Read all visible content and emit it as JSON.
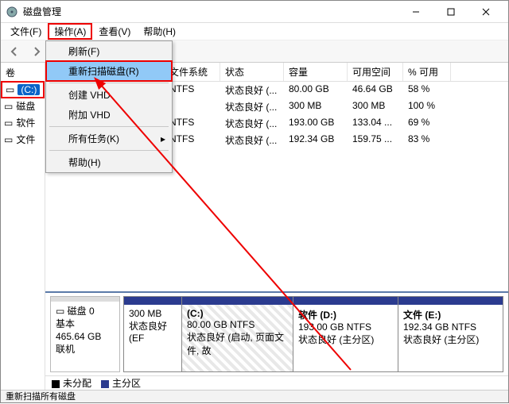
{
  "title": "磁盘管理",
  "menubar": {
    "file": "文件(F)",
    "action": "操作(A)",
    "view": "查看(V)",
    "help": "帮助(H)"
  },
  "dropdown": {
    "refresh": "刷新(F)",
    "rescan": "重新扫描磁盘(R)",
    "create_vhd": "创建 VHD",
    "attach_vhd": "附加 VHD",
    "all_tasks": "所有任务(K)",
    "help": "帮助(H)"
  },
  "left": {
    "header": "卷",
    "items": [
      "(C:)",
      "磁盘",
      "软件",
      "文件"
    ]
  },
  "grid": {
    "headers": {
      "fs": "文件系统",
      "status": "状态",
      "capacity": "容量",
      "free": "可用空间",
      "pct": "% 可用"
    },
    "rows": [
      {
        "fs": "NTFS",
        "status": "状态良好 (...",
        "capacity": "80.00 GB",
        "free": "46.64 GB",
        "pct": "58 %"
      },
      {
        "fs": "",
        "status": "状态良好 (...",
        "capacity": "300 MB",
        "free": "300 MB",
        "pct": "100 %"
      },
      {
        "fs": "NTFS",
        "status": "状态良好 (...",
        "capacity": "193.00 GB",
        "free": "133.04 ...",
        "pct": "69 %"
      },
      {
        "fs": "NTFS",
        "status": "状态良好 (...",
        "capacity": "192.34 GB",
        "free": "159.75 ...",
        "pct": "83 %"
      }
    ]
  },
  "disk": {
    "label": "磁盘 0",
    "type": "基本",
    "size": "465.64 GB",
    "state": "联机",
    "parts": [
      {
        "name": "",
        "size": "300 MB",
        "status": "状态良好 (EF"
      },
      {
        "name": "(C:)",
        "size": "80.00 GB NTFS",
        "status": "状态良好 (启动, 页面文件, 故"
      },
      {
        "name": "软件  (D:)",
        "size": "193.00 GB NTFS",
        "status": "状态良好 (主分区)"
      },
      {
        "name": "文件  (E:)",
        "size": "192.34 GB NTFS",
        "status": "状态良好 (主分区)"
      }
    ]
  },
  "legend": {
    "unalloc": "未分配",
    "primary": "主分区"
  },
  "status": "重新扫描所有磁盘"
}
